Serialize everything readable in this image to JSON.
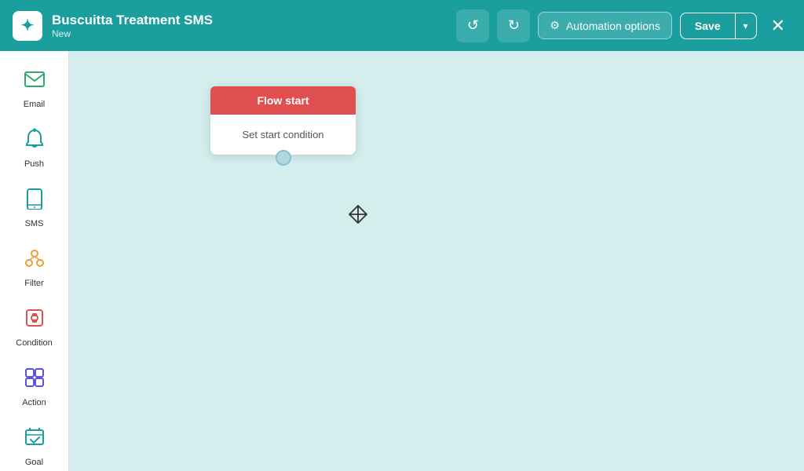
{
  "header": {
    "logo_symbol": "✦",
    "app_name": "Buscuitta Treatment SMS",
    "app_status": "New",
    "undo_label": "↺",
    "redo_label": "↻",
    "automation_options_label": "Automation options",
    "save_label": "Save",
    "save_dropdown_label": "▾",
    "close_label": "✕"
  },
  "sidebar": {
    "items": [
      {
        "id": "email",
        "label": "Email",
        "icon": "✉",
        "color": "#2eaa6e"
      },
      {
        "id": "push",
        "label": "Push",
        "icon": "🔔",
        "color": "#1a9e9e"
      },
      {
        "id": "sms",
        "label": "SMS",
        "icon": "📱",
        "color": "#1a9e9e"
      },
      {
        "id": "filter",
        "label": "Filter",
        "icon": "⑂",
        "color": "#e8a030"
      },
      {
        "id": "condition",
        "label": "Condition",
        "icon": "⚙",
        "color": "#e05050"
      },
      {
        "id": "action",
        "label": "Action",
        "icon": "⊞",
        "color": "#6050e0"
      },
      {
        "id": "goal",
        "label": "Goal",
        "icon": "⊟",
        "color": "#1a9e9e"
      }
    ]
  },
  "canvas": {
    "flow_node": {
      "header": "Flow start",
      "body": "Set start condition"
    }
  },
  "colors": {
    "header_bg": "#1a9e9e",
    "canvas_bg": "#d4eeee",
    "node_header_bg": "#e05050"
  }
}
